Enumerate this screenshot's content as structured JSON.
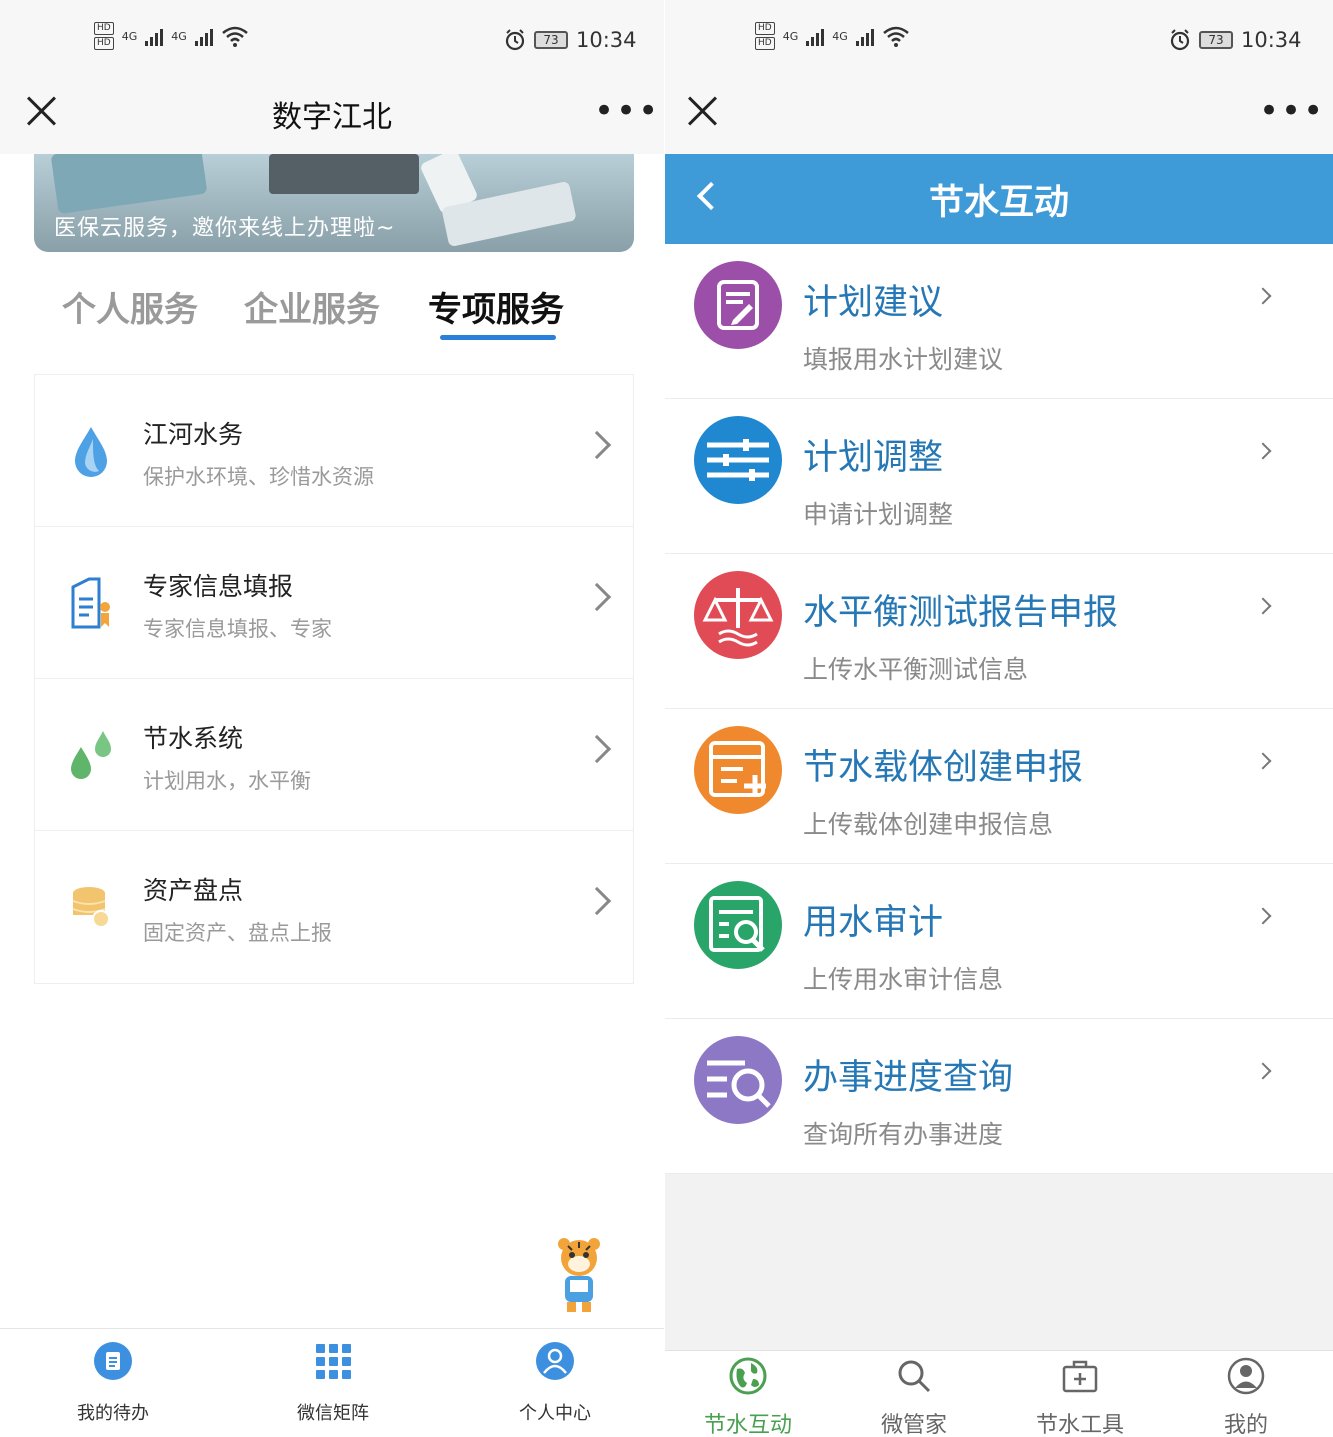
{
  "left": {
    "status": {
      "hd1": "HD",
      "hd2": "HD",
      "net1": "4G",
      "net2": "4G",
      "battery": "73",
      "time": "10:34"
    },
    "nav": {
      "title": "数字江北",
      "more": "•••"
    },
    "banner": {
      "text": "医保云服务，邀你来线上办理啦~"
    },
    "tabs": [
      {
        "label": "个人服务"
      },
      {
        "label": "企业服务"
      },
      {
        "label": "专项服务"
      }
    ],
    "items": [
      {
        "title": "江河水务",
        "subtitle": "保护水环境、珍惜水资源",
        "icon": "water-drop-icon"
      },
      {
        "title": "专家信息填报",
        "subtitle": "专家信息填报、专家",
        "icon": "expert-form-icon"
      },
      {
        "title": "节水系统",
        "subtitle": "计划用水，水平衡",
        "icon": "water-drops-icon"
      },
      {
        "title": "资产盘点",
        "subtitle": "固定资产、盘点上报",
        "icon": "coins-icon"
      }
    ],
    "bottom_nav": [
      {
        "label": "我的待办",
        "icon": "todo-icon"
      },
      {
        "label": "微信矩阵",
        "icon": "grid-icon"
      },
      {
        "label": "个人中心",
        "icon": "user-icon"
      }
    ]
  },
  "right": {
    "status": {
      "hd1": "HD",
      "hd2": "HD",
      "net1": "4G",
      "net2": "4G",
      "battery": "73",
      "time": "10:34"
    },
    "nav": {
      "more": "•••"
    },
    "header": {
      "title": "节水互动"
    },
    "items": [
      {
        "title": "计划建议",
        "subtitle": "填报用水计划建议",
        "color": "#9c4fa8",
        "icon": "edit-doc-icon"
      },
      {
        "title": "计划调整",
        "subtitle": "申请计划调整",
        "color": "#1f88d0",
        "icon": "sliders-icon"
      },
      {
        "title": "水平衡测试报告申报",
        "subtitle": "上传水平衡测试信息",
        "color": "#e04b56",
        "icon": "balance-scale-icon"
      },
      {
        "title": "节水载体创建申报",
        "subtitle": "上传载体创建申报信息",
        "color": "#f0892e",
        "icon": "form-add-icon"
      },
      {
        "title": "用水审计",
        "subtitle": "上传用水审计信息",
        "color": "#2aa56a",
        "icon": "audit-search-icon"
      },
      {
        "title": "办事进度查询",
        "subtitle": "查询所有办事进度",
        "color": "#8c78c4",
        "icon": "list-search-icon"
      }
    ],
    "bottom_nav": [
      {
        "label": "节水互动",
        "icon": "globe-icon"
      },
      {
        "label": "微管家",
        "icon": "search-icon"
      },
      {
        "label": "节水工具",
        "icon": "toolbox-icon"
      },
      {
        "label": "我的",
        "icon": "profile-icon"
      }
    ],
    "colors": {
      "header_bg": "#3f9ad8",
      "title_blue": "#2578b5",
      "active_green": "#4aa050"
    }
  }
}
